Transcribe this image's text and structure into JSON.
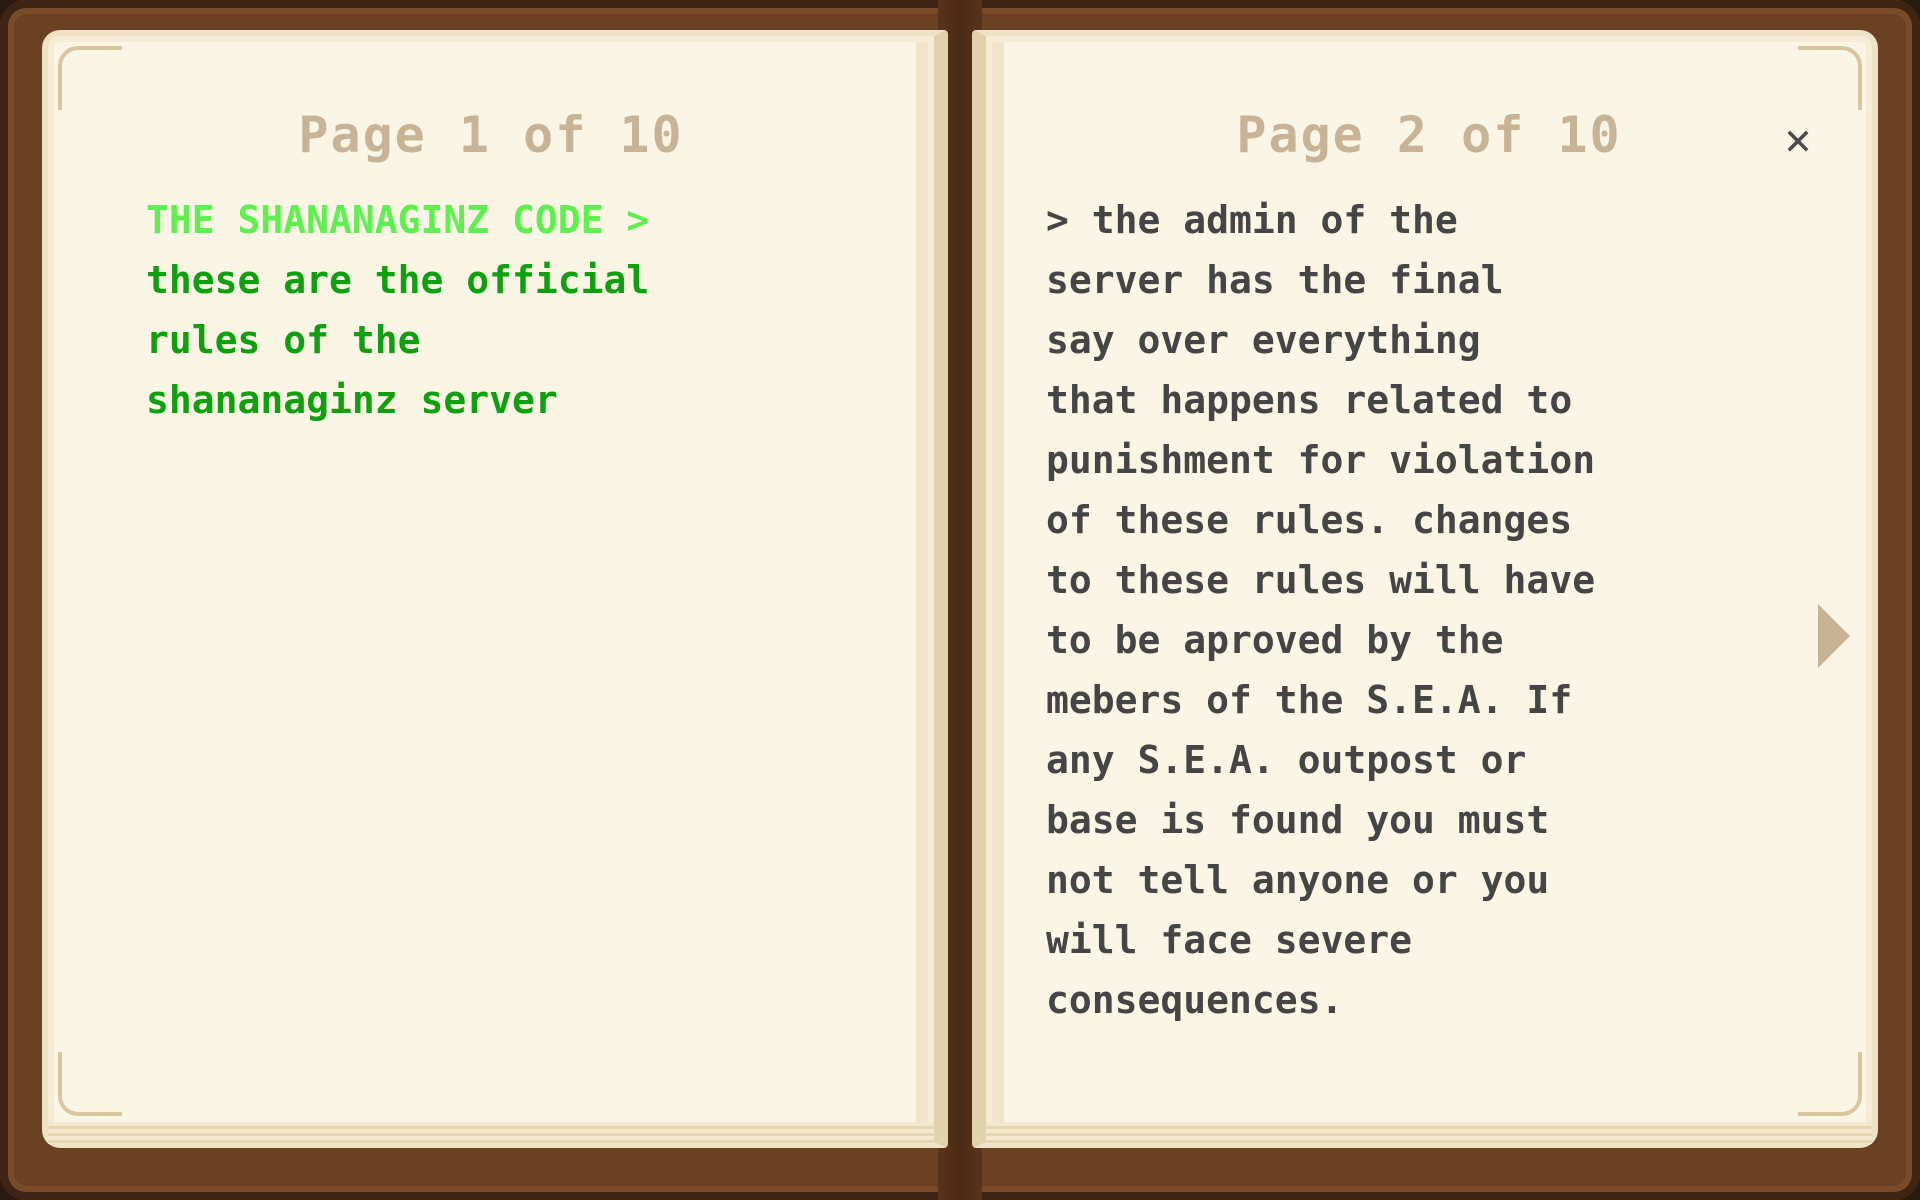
{
  "book": {
    "left_page": {
      "page_label": "Page 1 of 10",
      "heading": "THE SHANANAGINZ CODE >",
      "body": "these are the official\nrules of the\nshananaginz server"
    },
    "right_page": {
      "page_label": "Page 2 of 10",
      "body": "> the admin of the\nserver has the final\nsay over everything\nthat happens related to\npunishment for violation\nof these rules. changes\nto these rules will have\nto be aproved by the\nmebers of the S.E.A. If\nany S.E.A. outpost or\nbase is found you must\nnot tell anyone or you\nwill face severe\nconsequences."
    },
    "close_icon": "close-icon",
    "next_icon": "next-page-arrow-icon"
  },
  "colors": {
    "cover": "#6b4124",
    "page": "#fbf5e6",
    "heading_green": "#5ef04f",
    "body_green": "#0fa00f",
    "body_gray": "#454545",
    "page_label": "#c8b397"
  }
}
